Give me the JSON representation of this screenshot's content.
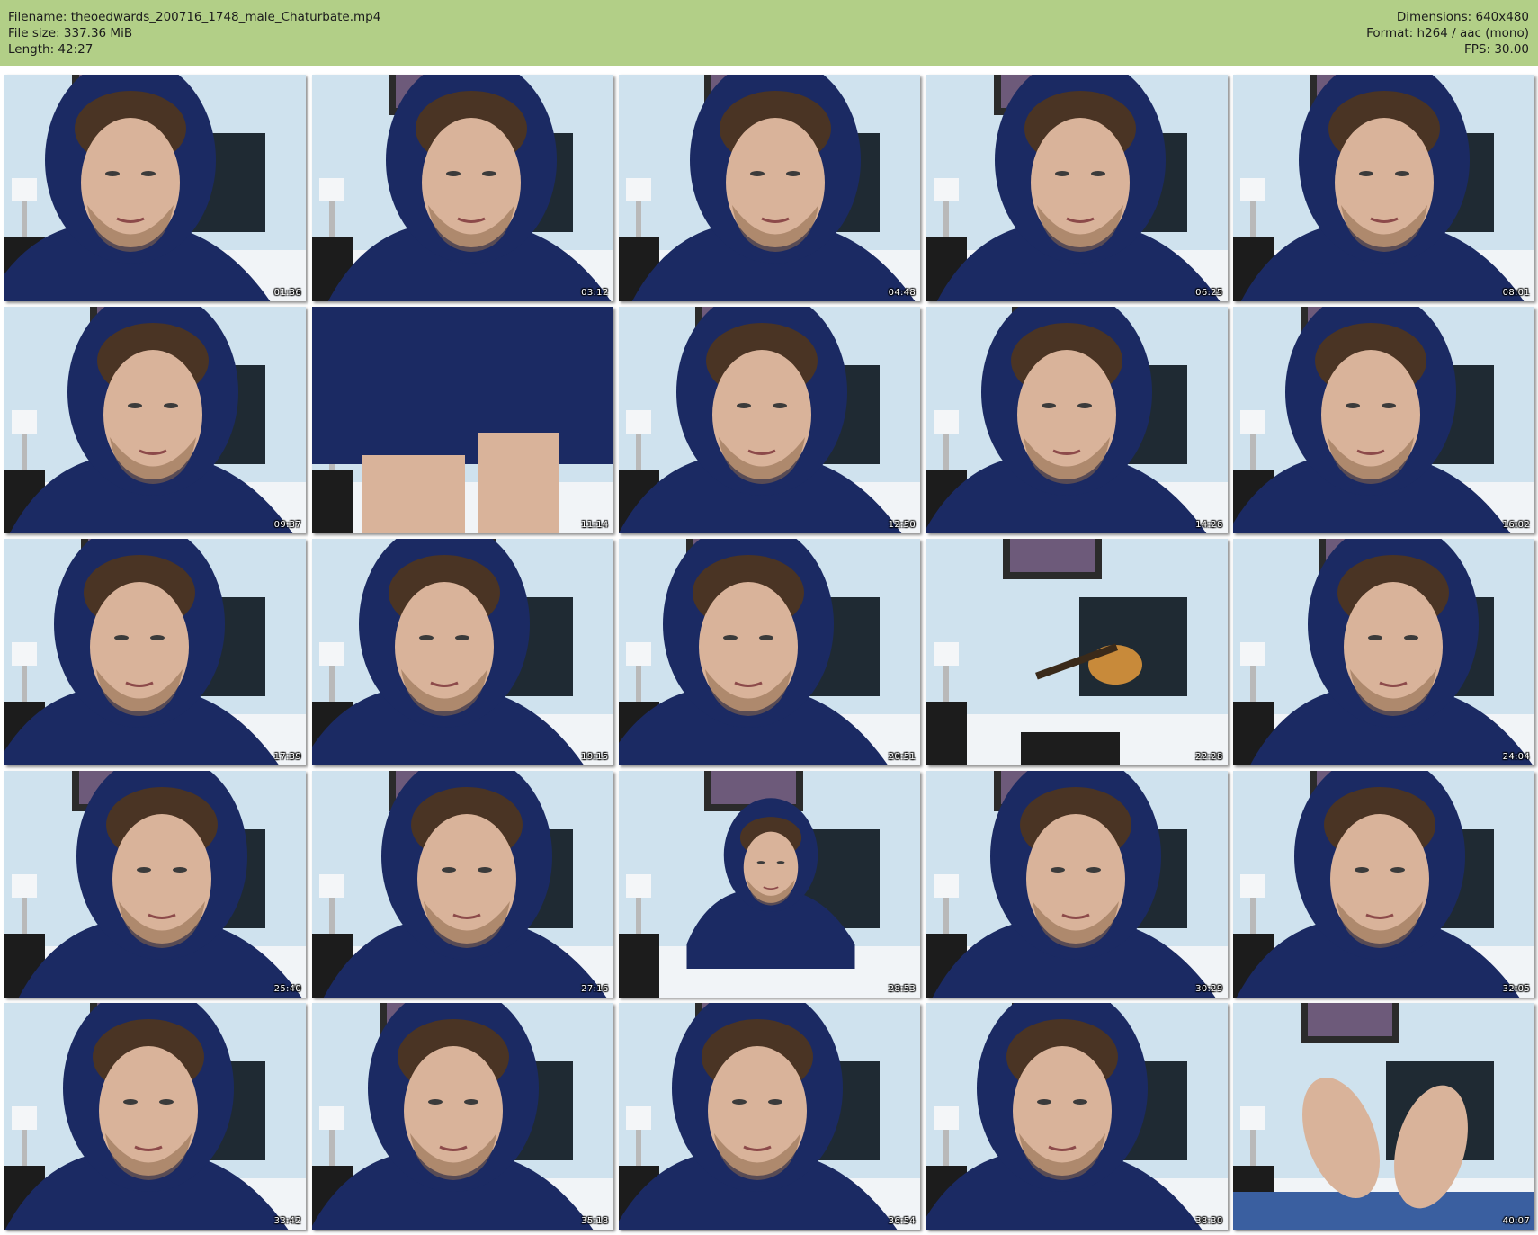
{
  "header": {
    "filename_label": "Filename: theoedwards_200716_1748_male_Chaturbate.mp4",
    "filesize_label": "File size: 337.36 MiB",
    "length_label": "Length: 42:27",
    "dimensions_label": "Dimensions: 640x480",
    "format_label": "Format: h264 / aac (mono)",
    "fps_label": "FPS: 30.00",
    "background_color": "#b2cf87"
  },
  "thumbnails": [
    {
      "timestamp": "01:36",
      "scene": "face-hood"
    },
    {
      "timestamp": "03:12",
      "scene": "face-hood"
    },
    {
      "timestamp": "04:48",
      "scene": "face-hood"
    },
    {
      "timestamp": "06:25",
      "scene": "face-hood"
    },
    {
      "timestamp": "08:01",
      "scene": "face-hood"
    },
    {
      "timestamp": "09:37",
      "scene": "face-hood"
    },
    {
      "timestamp": "11:14",
      "scene": "hoodie-closeup"
    },
    {
      "timestamp": "12:50",
      "scene": "face-hood"
    },
    {
      "timestamp": "14:26",
      "scene": "face-hood"
    },
    {
      "timestamp": "16:02",
      "scene": "face-hood"
    },
    {
      "timestamp": "17:39",
      "scene": "face-hood"
    },
    {
      "timestamp": "19:15",
      "scene": "face-hood"
    },
    {
      "timestamp": "20:51",
      "scene": "face-hood"
    },
    {
      "timestamp": "22:28",
      "scene": "empty-bed"
    },
    {
      "timestamp": "24:04",
      "scene": "face-hood"
    },
    {
      "timestamp": "25:40",
      "scene": "face-hood"
    },
    {
      "timestamp": "27:16",
      "scene": "face-hood"
    },
    {
      "timestamp": "28:53",
      "scene": "distant-figure"
    },
    {
      "timestamp": "30:29",
      "scene": "face-hood"
    },
    {
      "timestamp": "32:05",
      "scene": "face-hood"
    },
    {
      "timestamp": "33:42",
      "scene": "face-hood"
    },
    {
      "timestamp": "35:18",
      "scene": "face-hood"
    },
    {
      "timestamp": "36:54",
      "scene": "face-hood"
    },
    {
      "timestamp": "38:30",
      "scene": "face-hood"
    },
    {
      "timestamp": "40:07",
      "scene": "feet"
    }
  ],
  "colors": {
    "wall": "#cfe2ee",
    "headboard": "#1f2a33",
    "hoodie": "#1b2a63",
    "skin": "#d9b39a",
    "hair": "#4a3424",
    "bedding": "#f1f4f7"
  }
}
